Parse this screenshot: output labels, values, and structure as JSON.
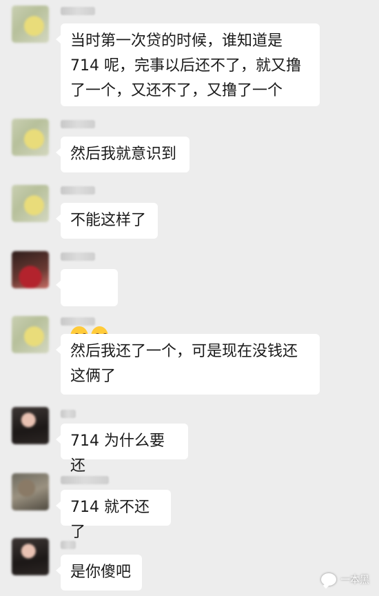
{
  "messages": [
    {
      "avatar": "yellow-blurred-avatar",
      "text": "当时第一次贷的时候，谁知道是\n714 呢，完事以后还不了，就又撸\n了一个，又还不了，又撸了一个"
    },
    {
      "avatar": "yellow-blurred-avatar",
      "text": "然后我就意识到"
    },
    {
      "avatar": "yellow-blurred-avatar",
      "text": "不能这样了"
    },
    {
      "avatar": "red-blurred-avatar",
      "emojis": [
        "crying-laughing-emoji",
        "crying-laughing-emoji"
      ]
    },
    {
      "avatar": "yellow-blurred-avatar",
      "text": "然后我还了一个，可是现在没钱还\n这俩了"
    },
    {
      "avatar": "dark-blurred-avatar",
      "text": "714 为什么要还"
    },
    {
      "avatar": "brown-blurred-avatar",
      "text": "714 就不还了"
    },
    {
      "avatar": "dark-blurred-avatar",
      "text": "是你傻吧"
    }
  ],
  "watermark": {
    "text": "一本黑",
    "icon": "chat-bubble-icon"
  }
}
